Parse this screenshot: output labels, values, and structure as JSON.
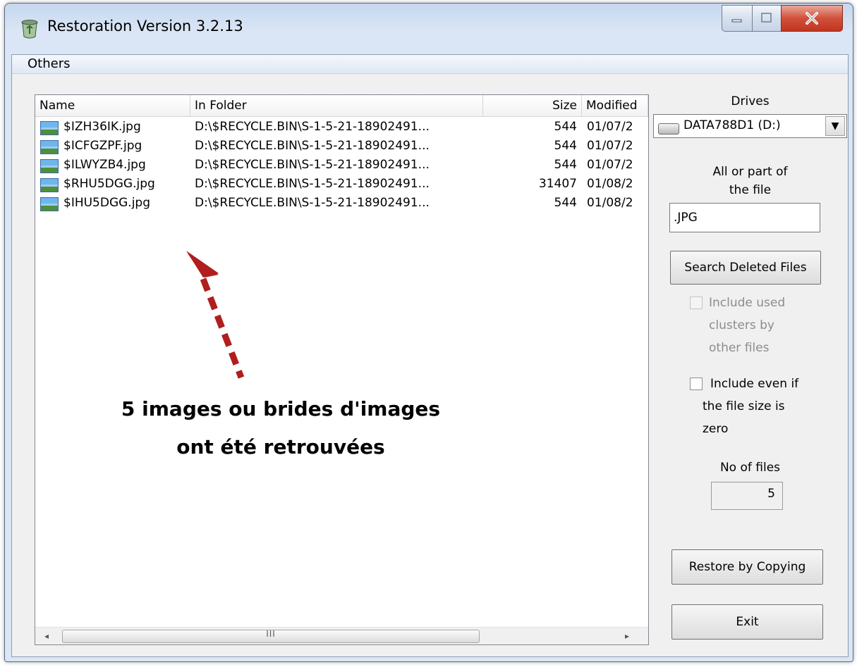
{
  "window": {
    "title": "Restoration Version 3.2.13",
    "controls": {
      "minimize": "–",
      "maximize": "□",
      "close": "X"
    }
  },
  "menu": {
    "items": [
      "Others"
    ]
  },
  "list": {
    "columns": [
      "Name",
      "In Folder",
      "Size",
      "Modified"
    ],
    "rows": [
      {
        "name": "$IZH36IK.jpg",
        "folder": "D:\\$RECYCLE.BIN\\S-1-5-21-18902491...",
        "size": "544",
        "modified": "01/07/2"
      },
      {
        "name": "$ICFGZPF.jpg",
        "folder": "D:\\$RECYCLE.BIN\\S-1-5-21-18902491...",
        "size": "544",
        "modified": "01/07/2"
      },
      {
        "name": "$ILWYZB4.jpg",
        "folder": "D:\\$RECYCLE.BIN\\S-1-5-21-18902491...",
        "size": "544",
        "modified": "01/07/2"
      },
      {
        "name": "$RHU5DGG.jpg",
        "folder": "D:\\$RECYCLE.BIN\\S-1-5-21-18902491...",
        "size": "31407",
        "modified": "01/08/2"
      },
      {
        "name": "$IHU5DGG.jpg",
        "folder": "D:\\$RECYCLE.BIN\\S-1-5-21-18902491...",
        "size": "544",
        "modified": "01/08/2"
      }
    ],
    "scrollbar": {
      "left_arrow": "◂",
      "right_arrow": "▸",
      "grip": "III"
    }
  },
  "panel": {
    "drives_label": "Drives",
    "drive_selected": "DATA788D1 (D:)",
    "drive_dropdown_arrow": "▼",
    "search_label_line1": "All or part of",
    "search_label_line2": "the file",
    "search_value": ".JPG",
    "search_button": "Search Deleted Files",
    "include_used_lines": [
      "Include used",
      "clusters by",
      "other files"
    ],
    "include_zero_lines": [
      "Include even if",
      "the file size is",
      "zero"
    ],
    "no_of_files_label": "No of files",
    "no_of_files_value": "5",
    "restore_button": "Restore by Copying",
    "exit_button": "Exit"
  },
  "annotation": {
    "line1": "5 images ou brides d'images",
    "line2": "ont été retrouvées",
    "arrow_color": "#b01e1e"
  }
}
